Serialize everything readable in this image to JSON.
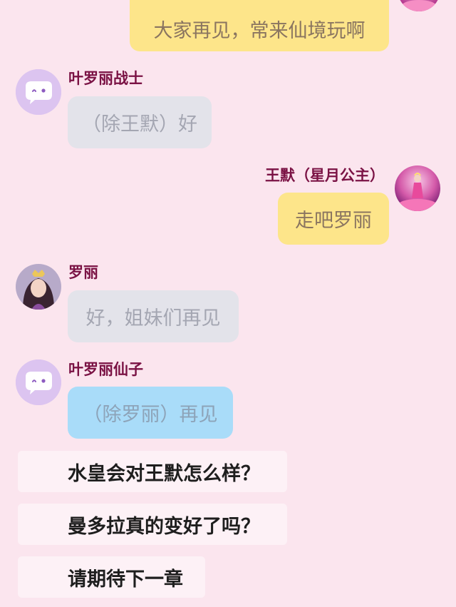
{
  "chat": {
    "messages": [
      {
        "sender": "",
        "text": "大家再见，常来仙境玩啊",
        "side": "right",
        "bubble": "yellow"
      },
      {
        "sender": "叶罗丽战士",
        "text": "（除王默）好",
        "side": "left",
        "bubble": "gray"
      },
      {
        "sender": "王默（星月公主）",
        "text": "走吧罗丽",
        "side": "right",
        "bubble": "yellow"
      },
      {
        "sender": "罗丽",
        "text": "好，姐妹们再见",
        "side": "left",
        "bubble": "gray"
      },
      {
        "sender": "叶罗丽仙子",
        "text": "（除罗丽）再见",
        "side": "left",
        "bubble": "blue"
      }
    ]
  },
  "questions": [
    "水皇会对王默怎么样？",
    "曼多拉真的变好了吗？",
    "请期待下一章"
  ],
  "colors": {
    "background": "#fbe5ee",
    "name_text": "#7a1244",
    "bubble_yellow": "#fde58a",
    "bubble_gray": "#e3e3ea",
    "bubble_blue": "#a9dcf9",
    "question_card": "#fdf1f6"
  },
  "icons": {
    "default_avatar": "chat-bubble-wink-icon"
  }
}
